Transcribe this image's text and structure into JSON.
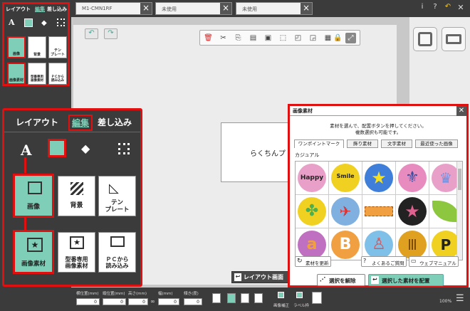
{
  "tabs": [
    {
      "label": "M1-CMN1RF"
    },
    {
      "label": "未使用"
    },
    {
      "label": "未使用"
    }
  ],
  "title_icons": {
    "info": "i",
    "help": "?",
    "undo": "↶"
  },
  "small_panel": {
    "tabs": [
      "レイアウト",
      "編集",
      "差し込み"
    ],
    "items": [
      "画像",
      "背景",
      "テン\nプレート",
      "画像素材",
      "型番専用\n画像素材",
      "ＰＣから\n読み込み"
    ]
  },
  "big_panel": {
    "tab_layout": "レイアウト",
    "tab_edit": "編集",
    "tab_merge": "差し込み",
    "items": [
      {
        "label": "画像"
      },
      {
        "label": "背景"
      },
      {
        "label": "テン\nプレート"
      },
      {
        "label": "画像素材"
      },
      {
        "label": "型番専用\n画像素材"
      },
      {
        "label": "ＰＣから\n読み込み"
      }
    ]
  },
  "canvas": {
    "text": "らくちんプ",
    "layout_button": "レイアウト画面"
  },
  "dialog": {
    "title": "画像素材",
    "instruction1": "素材を選んで、配置ボタンを押してください。",
    "instruction2": "複数選択も可能です。",
    "tabs": [
      "ワンポイントマーク",
      "飾り素材",
      "文字素材",
      "最近使った画像"
    ],
    "category": "カジュアル",
    "update_label": "素材を更新",
    "faq_label": "よくあるご質問",
    "manual_label": "ウェブマニュアル",
    "deselect_label": "選択を解除",
    "place_label": "選択した素材を配置"
  },
  "bottom": {
    "labels": [
      "横位置(mm)",
      "縦位置(mm)",
      "高さ(mm)",
      "幅(mm)",
      "傾き(度)"
    ],
    "values": [
      "0",
      "0",
      "0",
      "0",
      "0"
    ],
    "toggles": [
      "画像補正",
      "ラベル枠"
    ],
    "zoom": "100%"
  }
}
